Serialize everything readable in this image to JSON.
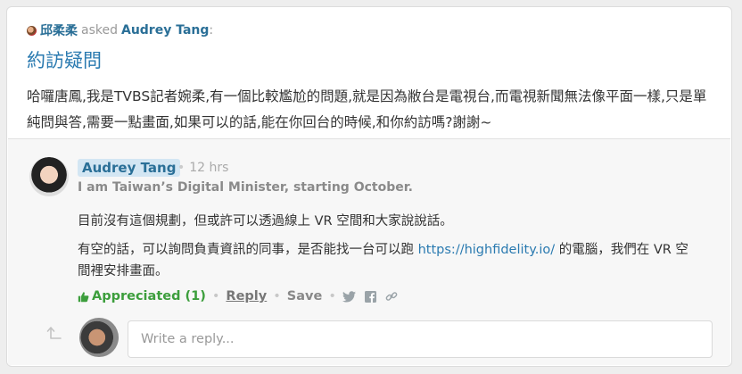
{
  "question": {
    "asker_name": "邱柔柔",
    "asked_text": "asked",
    "recipient": "Audrey Tang",
    "colon": ":",
    "title": "約訪疑問",
    "body": "哈囉唐鳳,我是TVBS記者婉柔,有一個比較尷尬的問題,就是因為敝台是電視台,而電視新聞無法像平面一樣,只是單純問與答,需要一點畫面,如果可以的話,能在你回台的時候,和你約訪嗎?謝謝~"
  },
  "answer": {
    "author": "Audrey Tang",
    "time": "12 hrs",
    "bio": "I am Taiwan’s Digital Minister, starting October.",
    "p1": "目前沒有這個規劃，但或許可以透過線上 VR 空間和大家說說話。",
    "p2_before": "有空的話，可以詢問負責資訊的同事，是否能找一台可以跑 ",
    "p2_link": "https://highfidelity.io/",
    "p2_after": " 的電腦，我們在 VR 空間裡安排畫面。",
    "actions": {
      "appreciated": "Appreciated (1)",
      "reply": "Reply",
      "save": "Save"
    },
    "share_icons": [
      "twitter-icon",
      "facebook-icon",
      "link-icon"
    ]
  },
  "reply_box": {
    "placeholder": "Write a reply..."
  },
  "colors": {
    "link": "#2a7ab0",
    "name_badge_bg": "#d3e6f3",
    "appreciated_green": "#3c9e3c"
  }
}
